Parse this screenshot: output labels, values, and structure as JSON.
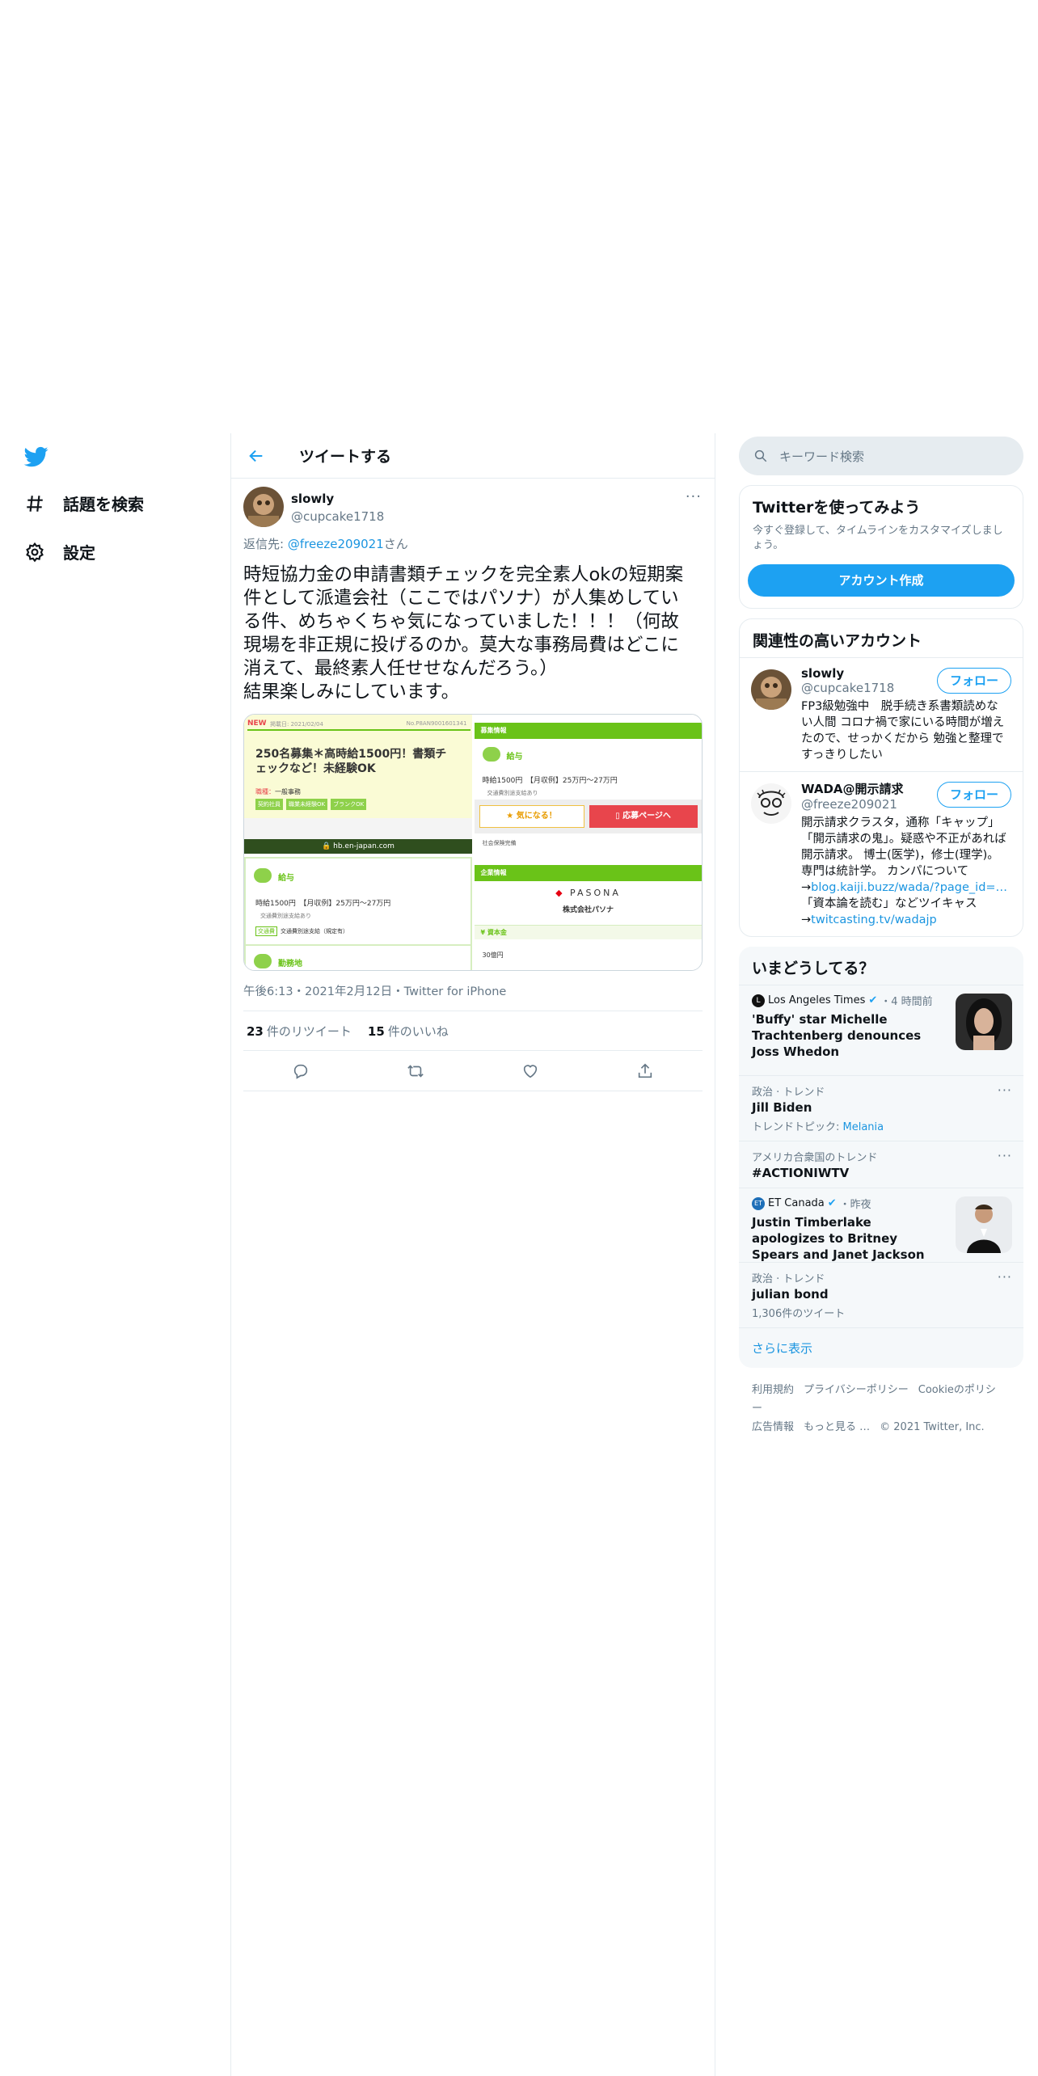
{
  "nav": {
    "explore_label": "話題を検索",
    "settings_label": "設定"
  },
  "header": {
    "title": "ツイートする"
  },
  "tweet": {
    "author_name": "slowly",
    "author_handle": "@cupcake1718",
    "reply_prefix": "返信先: ",
    "reply_to": "@freeze209021",
    "reply_suffix": "さん",
    "text": "時短協力金の申請書類チェックを完全素人okの短期案\n件として派遣会社（ここではパソナ）が人集めしてい\nる件、めちゃくちゃ気になっていました！！！（何故\n現場を非正規に投げるのか。莫大な事務局費はどこに\n消えて、最終素人任せせなんだろう。）\n結果楽しみにしています。",
    "meta": "午後6:13・2021年2月12日・Twitter for iPhone",
    "retweets_count": "23",
    "retweets_label": "件のリツイート",
    "likes_count": "15",
    "likes_label": "件のいいね",
    "media": {
      "left": {
        "new_badge": "NEW",
        "posted": "掲載日: 2021/02/04",
        "job_no": "No.P8AN9001601341",
        "headline": "250名募集＊高時給1500円！書類チェックなど！未経験OK",
        "job_type_label": "職種：",
        "job_type": "一般事務",
        "tags": [
          "契約社員",
          "職業未経験OK",
          "ブランクOK"
        ],
        "url": "hb.en-japan.com",
        "salary_title": "給与",
        "salary_text": "時給1500円　【月収例】25万円〜27万円",
        "transport_note": "交通費別途支給あり",
        "transport_tag": "交通費",
        "transport_text": "交通費別途支給（規定有）",
        "next_title": "勤務地"
      },
      "right": {
        "section1": "募集情報",
        "salary_title": "給与",
        "salary_text": "時給1500円　【月収例】25万円〜27万円",
        "transport_note": "交通費別途支給あり",
        "interested_btn": "気になる！",
        "apply_btn": "応募ページへ",
        "insurance": "社会保険完備",
        "section2": "企業情報",
        "brand": "PASONA",
        "company": "株式会社パソナ",
        "capital_title": "資本金",
        "capital_value": "30億円"
      }
    }
  },
  "search": {
    "placeholder": "キーワード検索"
  },
  "signup": {
    "title": "Twitterを使ってみよう",
    "desc": "今すぐ登録して、タイムラインをカスタマイズしましょう。",
    "button": "アカウント作成"
  },
  "related": {
    "title": "関連性の高いアカウント",
    "follow_label": "フォロー",
    "accounts": [
      {
        "name": "slowly",
        "handle": "@cupcake1718",
        "bio": "FP3級勉強中　脱手続き系書類読めない人間 コロナ禍で家にいる時間が増えたので、せっかくだから 勉強と整理ですっきりしたい"
      },
      {
        "name": "WADA@開示請求",
        "handle": "@freeze209021",
        "bio": "開示請求クラスタ，通称「キャップ」「開示請求の鬼」。疑惑や不正があれば開示請求。 博士(医学)，修士(理学)。専門は統計学。 カンパについて",
        "link1_prefix": "→",
        "link1": "blog.kaiji.buzz/wada/?page_id=…",
        "bio2": "「資本論を読む」などツイキャス",
        "link2_prefix": "→",
        "link2": "twitcasting.tv/wadajp"
      }
    ]
  },
  "trends": {
    "title": "いまどうしてる？",
    "items": [
      {
        "source": "Los Angeles Times",
        "time": "・4 時間前",
        "text": "'Buffy' star Michelle Trachtenberg denounces Joss Whedon"
      },
      {
        "category": "政治 · トレンド",
        "name": "Jill Biden",
        "topic_label": "トレンドトピック: ",
        "topic": "Melania"
      },
      {
        "category": "アメリカ合衆国のトレンド",
        "name": "#ACTIONIWTV"
      },
      {
        "source": "ET Canada",
        "time": "・昨夜",
        "text": "Justin Timberlake apologizes to Britney Spears and Janet Jackson"
      },
      {
        "category": "政治 · トレンド",
        "name": "julian bond",
        "count": "1,306件のツイート"
      }
    ],
    "show_more": "さらに表示"
  },
  "footer": {
    "links": [
      "利用規約",
      "プライバシーポリシー",
      "Cookieのポリシー",
      "広告情報",
      "もっと見る …"
    ],
    "copyright": "© 2021 Twitter, Inc."
  },
  "colors": {
    "brand_blue": "#1da1f2",
    "link_blue": "#1b95e0",
    "job_green": "#6ac318",
    "apply_red": "#e8454c"
  }
}
